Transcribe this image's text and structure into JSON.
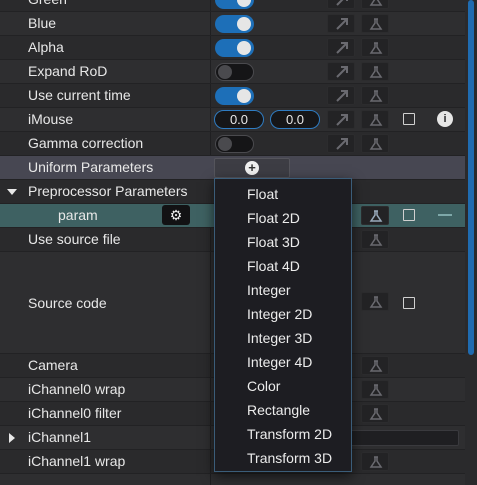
{
  "colors": {
    "accent": "#1d6fb8",
    "selected_row": "#3e6162",
    "highlight_row": "#474752"
  },
  "rows": {
    "green": {
      "label": "Green",
      "toggle": true
    },
    "blue": {
      "label": "Blue",
      "toggle": true
    },
    "alpha": {
      "label": "Alpha",
      "toggle": true
    },
    "expand_rod": {
      "label": "Expand RoD",
      "toggle": false
    },
    "use_current_time": {
      "label": "Use current time",
      "toggle": true
    },
    "imouse": {
      "label": "iMouse",
      "x": "0.0",
      "y": "0.0"
    },
    "gamma_correction": {
      "label": "Gamma correction",
      "toggle": false
    },
    "uniform_parameters": {
      "label": "Uniform Parameters"
    },
    "preprocessor_parameters": {
      "label": "Preprocessor Parameters",
      "expanded": true
    },
    "param": {
      "label": "param"
    },
    "use_source_file": {
      "label": "Use source file"
    },
    "source_code": {
      "label": "Source code"
    },
    "camera": {
      "label": "Camera"
    },
    "ichannel0_wrap": {
      "label": "iChannel0 wrap"
    },
    "ichannel0_filter": {
      "label": "iChannel0 filter"
    },
    "ichannel1": {
      "label": "iChannel1",
      "expanded": false
    },
    "ichannel1_wrap": {
      "label": "iChannel1 wrap"
    }
  },
  "icons": {
    "link": "link-arrow-icon",
    "flask": "flask-icon",
    "gear": "gear-icon",
    "plus": "plus-circle-icon",
    "info": "info-icon"
  },
  "icon_glyphs": {
    "gear": "⚙",
    "plus": "+",
    "info": "i"
  },
  "dropdown": {
    "items": [
      "Float",
      "Float 2D",
      "Float 3D",
      "Float 4D",
      "Integer",
      "Integer 2D",
      "Integer 3D",
      "Integer 4D",
      "Color",
      "Rectangle",
      "Transform 2D",
      "Transform 3D"
    ]
  }
}
